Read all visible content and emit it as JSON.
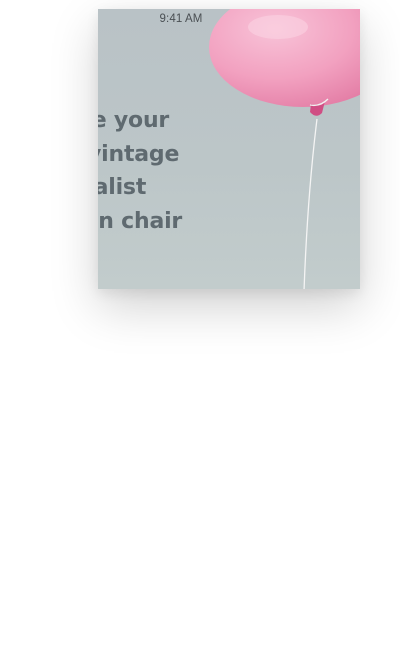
{
  "status_bar": {
    "time": "9:41 AM",
    "battery_icon": "battery-full-icon"
  },
  "hero": {
    "headline_lines": [
      "Update your",
      "vintage",
      "minimalist",
      "wooden chair"
    ],
    "image": "pink-balloon-image",
    "colors": {
      "background": "#bcc6c8",
      "headline": "#5f6a70",
      "balloon": "#f2a3c2"
    }
  }
}
